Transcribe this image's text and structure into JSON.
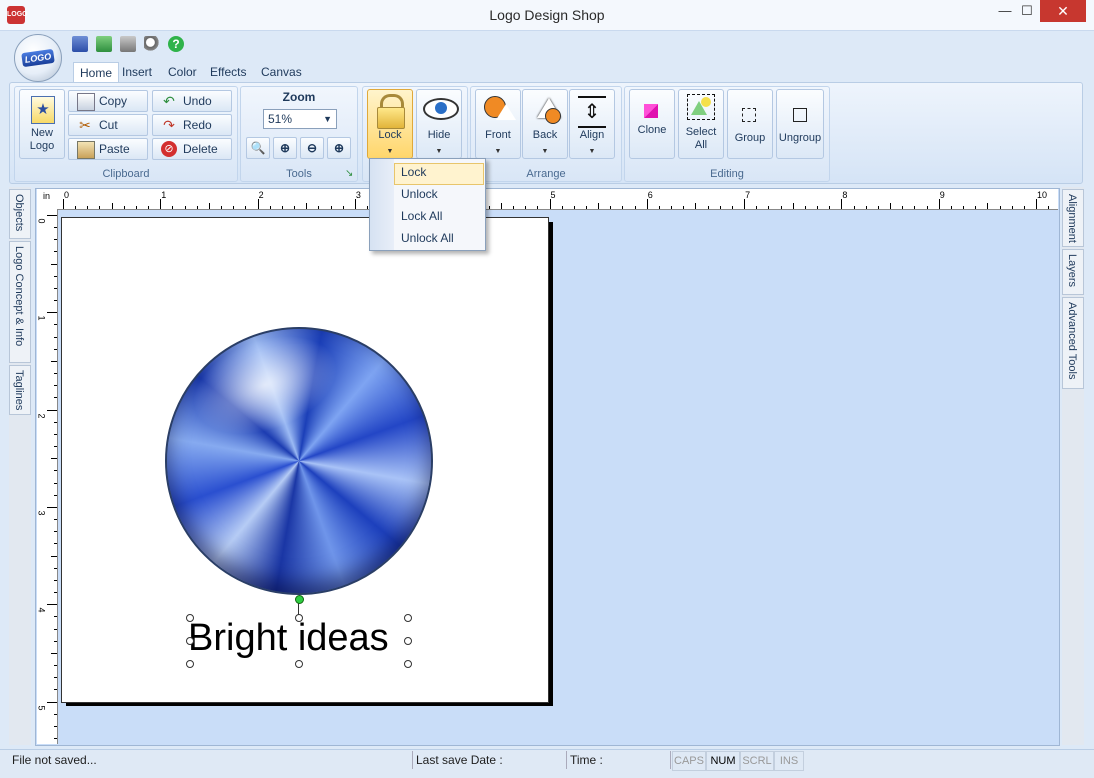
{
  "window": {
    "title": "Logo Design Shop",
    "icon_text": "LOGO",
    "minimize": "—",
    "restore": "☐",
    "close": "✕"
  },
  "app_orb": {
    "text": "LOGO"
  },
  "tabs": [
    {
      "label": "Home"
    },
    {
      "label": "Insert"
    },
    {
      "label": "Color"
    },
    {
      "label": "Effects"
    },
    {
      "label": "Canvas"
    }
  ],
  "ribbon": {
    "clipboard": {
      "label": "Clipboard",
      "new_logo": "New Logo",
      "copy": "Copy",
      "cut": "Cut",
      "paste": "Paste",
      "undo": "Undo",
      "redo": "Redo",
      "delete": "Delete"
    },
    "tools": {
      "label": "Tools",
      "zoom_label": "Zoom",
      "zoom_value": "51%"
    },
    "lockhide": {
      "lock": "Lock",
      "hide": "Hide"
    },
    "arrange": {
      "label": "Arrange",
      "front": "Front",
      "back": "Back",
      "align": "Align"
    },
    "editing": {
      "label": "Editing",
      "clone": "Clone",
      "select_all": "Select All",
      "group": "Group",
      "ungroup": "Ungroup"
    }
  },
  "lock_menu": {
    "items": [
      "Lock",
      "Unlock",
      "Lock All",
      "Unlock All"
    ]
  },
  "left_tabs": [
    "Objects",
    "Logo Concept & Info",
    "Taglines"
  ],
  "right_tabs": [
    "Alignment",
    "Layers",
    "Advanced Tools"
  ],
  "ruler": {
    "unit": "in",
    "h_ticks": [
      "0",
      "1",
      "2",
      "3",
      "4",
      "5",
      "6",
      "7",
      "8",
      "9",
      "10"
    ],
    "v_ticks": [
      "0",
      "1",
      "2",
      "3",
      "4",
      "5"
    ]
  },
  "canvas": {
    "tagline": "Bright ideas"
  },
  "status": {
    "file": "File not saved...",
    "last_save": "Last save Date :",
    "time": "Time :",
    "caps": "CAPS",
    "num": "NUM",
    "scrl": "SCRL",
    "ins": "INS"
  },
  "colors": {
    "accent": "#2346c6",
    "ribbon_bg": "#d5e4f6",
    "workspace": "#c9ddf8",
    "close_btn": "#c7372f"
  }
}
